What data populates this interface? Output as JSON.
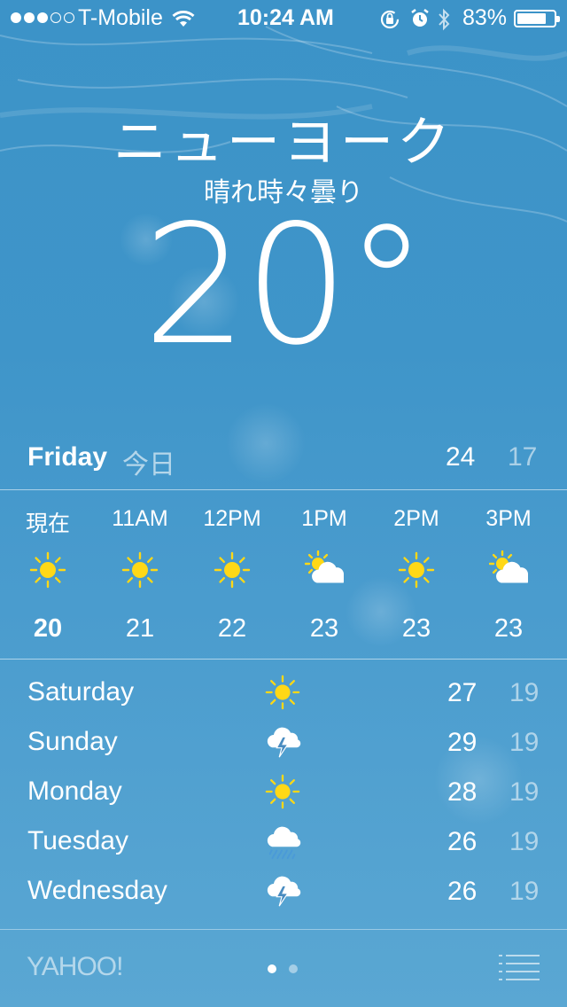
{
  "status_bar": {
    "signal_dots": [
      true,
      true,
      true,
      false,
      false
    ],
    "carrier": "T-Mobile",
    "time": "10:24 AM",
    "battery_percent": "83%",
    "battery_level": 0.83
  },
  "current": {
    "city": "ニューヨーク",
    "condition": "晴れ時々曇り",
    "temperature": "20°"
  },
  "today": {
    "day": "Friday",
    "label": "今日",
    "high": "24",
    "low": "17"
  },
  "hourly": [
    {
      "label": "現在",
      "icon": "sun-icon",
      "temp": "20",
      "now": true
    },
    {
      "label": "11AM",
      "icon": "sun-icon",
      "temp": "21",
      "now": false
    },
    {
      "label": "12PM",
      "icon": "sun-icon",
      "temp": "22",
      "now": false
    },
    {
      "label": "1PM",
      "icon": "partly-cloudy-icon",
      "temp": "23",
      "now": false
    },
    {
      "label": "2PM",
      "icon": "sun-icon",
      "temp": "23",
      "now": false
    },
    {
      "label": "3PM",
      "icon": "partly-cloudy-icon",
      "temp": "23",
      "now": false
    }
  ],
  "daily": [
    {
      "day": "Saturday",
      "icon": "sun-icon",
      "high": "27",
      "low": "19"
    },
    {
      "day": "Sunday",
      "icon": "thunderstorm-icon",
      "high": "29",
      "low": "19"
    },
    {
      "day": "Monday",
      "icon": "sun-icon",
      "high": "28",
      "low": "19"
    },
    {
      "day": "Tuesday",
      "icon": "rain-cloud-icon",
      "high": "26",
      "low": "19"
    },
    {
      "day": "Wednesday",
      "icon": "thunderstorm-icon",
      "high": "26",
      "low": "19"
    }
  ],
  "footer": {
    "provider": "YAHOO!",
    "pages": 2,
    "active_page": 0
  },
  "colors": {
    "sun": "#ffd816",
    "cloud": "#ffffff",
    "bolt": "#4a8cc0",
    "rain": "#4a9ad8"
  }
}
